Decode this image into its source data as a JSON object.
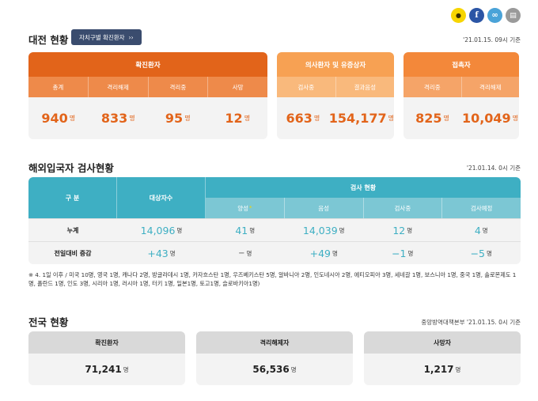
{
  "share": {
    "kakao_glyph": "●",
    "facebook_glyph": "f",
    "link_glyph": "∞",
    "print_glyph": "▤"
  },
  "daejeon": {
    "title": "대전 현황",
    "button_label": "자치구별 확진환자",
    "button_arrow": "››",
    "date": "'21.01.15. 09시 기준",
    "confirmed": {
      "header": "확진환자",
      "cols": [
        "총계",
        "격리해제",
        "격리중",
        "사망"
      ],
      "values": [
        "940",
        "833",
        "95",
        "12"
      ]
    },
    "suspected": {
      "header": "의사환자 및 유증상자",
      "cols": [
        "검사중",
        "결과음성"
      ],
      "values": [
        "663",
        "154,177"
      ]
    },
    "contacts": {
      "header": "접촉자",
      "cols": [
        "격리중",
        "격리해제"
      ],
      "values": [
        "825",
        "10,049"
      ]
    },
    "unit": "명"
  },
  "overseas": {
    "title": "해외입국자 검사현황",
    "date": "'21.01.14. 0시 기준",
    "head_category": "구 분",
    "head_target": "대상자수",
    "head_group": "검사 현황",
    "sub_cols": [
      "양성",
      "음성",
      "검사중",
      "검사예정"
    ],
    "star": "*",
    "rows": [
      {
        "label": "누계",
        "target": "14,096",
        "values": [
          "41",
          "14,039",
          "12",
          "4"
        ]
      },
      {
        "label": "전일대비 증감",
        "target": "+43",
        "values": [
          "−",
          "+49",
          "−1",
          "−5"
        ]
      }
    ],
    "unit": "명",
    "note": "※ 4. 1일 이후 / 미국 10명, 영국 1명, 캐나다 2명, 방글라데시 1명, 카자흐스탄 1명, 우즈베키스탄 5명, 알바니아 2명, 인도네시아 2명, 에티오피아 3명, 세네갈 1명, 보스니아 1명, 중국 1명, 솔로몬제도 1명, 폴란드 1명, 인도 3명, 시리아 1명, 러시아 1명, 터키 1명, 일본1명, 토고1명, 슬로바키아1명)"
  },
  "national": {
    "title": "전국 현황",
    "date": "중앙방역대책본부 '21.01.15. 0시 기준",
    "cards": [
      {
        "label": "확진환자",
        "value": "71,241"
      },
      {
        "label": "격리해제자",
        "value": "56,536"
      },
      {
        "label": "사망자",
        "value": "1,217"
      }
    ],
    "unit": "명"
  },
  "colors": {
    "orange_dark": "#e2641a",
    "orange_light": "#f7a153",
    "teal": "#3eafc3",
    "navy": "#3a4c6e"
  }
}
